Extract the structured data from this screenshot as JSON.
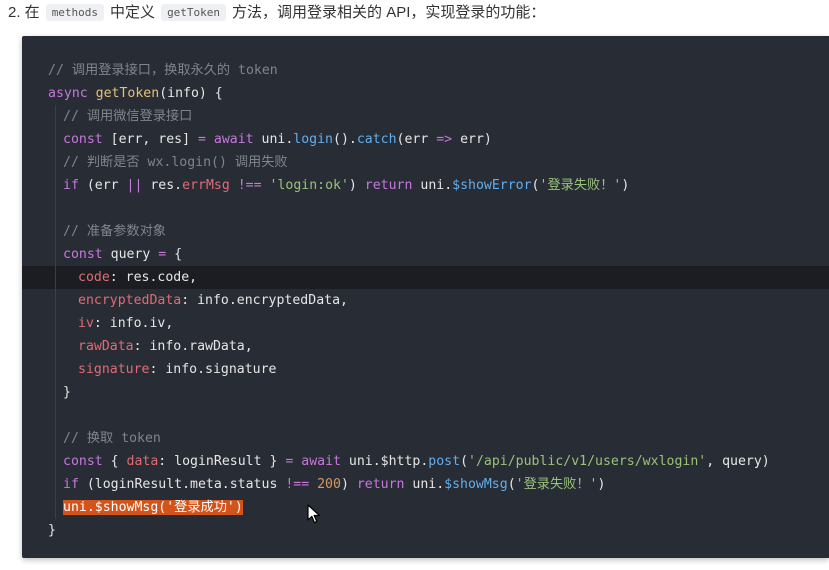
{
  "intro": {
    "prefix": "2. 在",
    "term1": "methods",
    "mid": "中定义",
    "term2": "getToken",
    "suffix": "方法，调用登录相关的 API，实现登录的功能："
  },
  "code": {
    "l1_comment": "// 调用登录接口，换取永久的 token",
    "l2_async": "async",
    "l2_fn": "getToken",
    "l2_rest": "(info) {",
    "l3_comment": "// 调用微信登录接口",
    "l4_const": "const",
    "l4_a": " [err, res] ",
    "l4_eq": "=",
    "l4_sp": " ",
    "l4_await": "await",
    "l4_b": " uni.",
    "l4_login": "login",
    "l4_c": "().",
    "l4_catch": "catch",
    "l4_d": "(err ",
    "l4_arrow": "=>",
    "l4_e": " err)",
    "l5_comment": "// 判断是否 wx.login() 调用失败",
    "l6_if": "if",
    "l6_a": " (err ",
    "l6_or": "||",
    "l6_b": " res.",
    "l6_prop": "errMsg",
    "l6_sp": " ",
    "l6_neq": "!==",
    "l6_sp2": " ",
    "l6_str": "'login:ok'",
    "l6_c": ") ",
    "l6_return": "return",
    "l6_d": " uni.",
    "l6_method": "$showError",
    "l6_e": "(",
    "l6_str2": "'登录失败！'",
    "l6_f": ")",
    "l8_comment": "// 准备参数对象",
    "l9_const": "const",
    "l9_a": " query ",
    "l9_eq": "=",
    "l9_b": " {",
    "l10_key": "code",
    "l10_val": ": res.code,",
    "l11_key": "encryptedData",
    "l11_val": ": info.encryptedData,",
    "l12_key": "iv",
    "l12_val": ": info.iv,",
    "l13_key": "rawData",
    "l13_val": ": info.rawData,",
    "l14_key": "signature",
    "l14_val": ": info.signature",
    "l15": "}",
    "l17_comment": "// 换取 token",
    "l18_const": "const",
    "l18_a": " { ",
    "l18_key": "data",
    "l18_b": ": loginResult } ",
    "l18_eq": "=",
    "l18_sp": " ",
    "l18_await": "await",
    "l18_c": " uni.$http.",
    "l18_post": "post",
    "l18_d": "(",
    "l18_str": "'/api/public/v1/users/wxlogin'",
    "l18_e": ", query)",
    "l19_if": "if",
    "l19_a": " (loginResult.meta.status ",
    "l19_neq": "!==",
    "l19_sp": " ",
    "l19_num": "200",
    "l19_b": ") ",
    "l19_return": "return",
    "l19_c": " uni.",
    "l19_method": "$showMsg",
    "l19_d": "(",
    "l19_str": "'登录失败！'",
    "l19_e": ")",
    "l20_selected": "uni.$showMsg('登录成功')",
    "l21": "}"
  },
  "colors": {
    "background": "#282c34",
    "selection": "#d2541a",
    "comment": "#7f848e",
    "keyword": "#c678dd",
    "string": "#98c379"
  },
  "icons": {
    "cursor": "mouse-pointer-icon"
  }
}
